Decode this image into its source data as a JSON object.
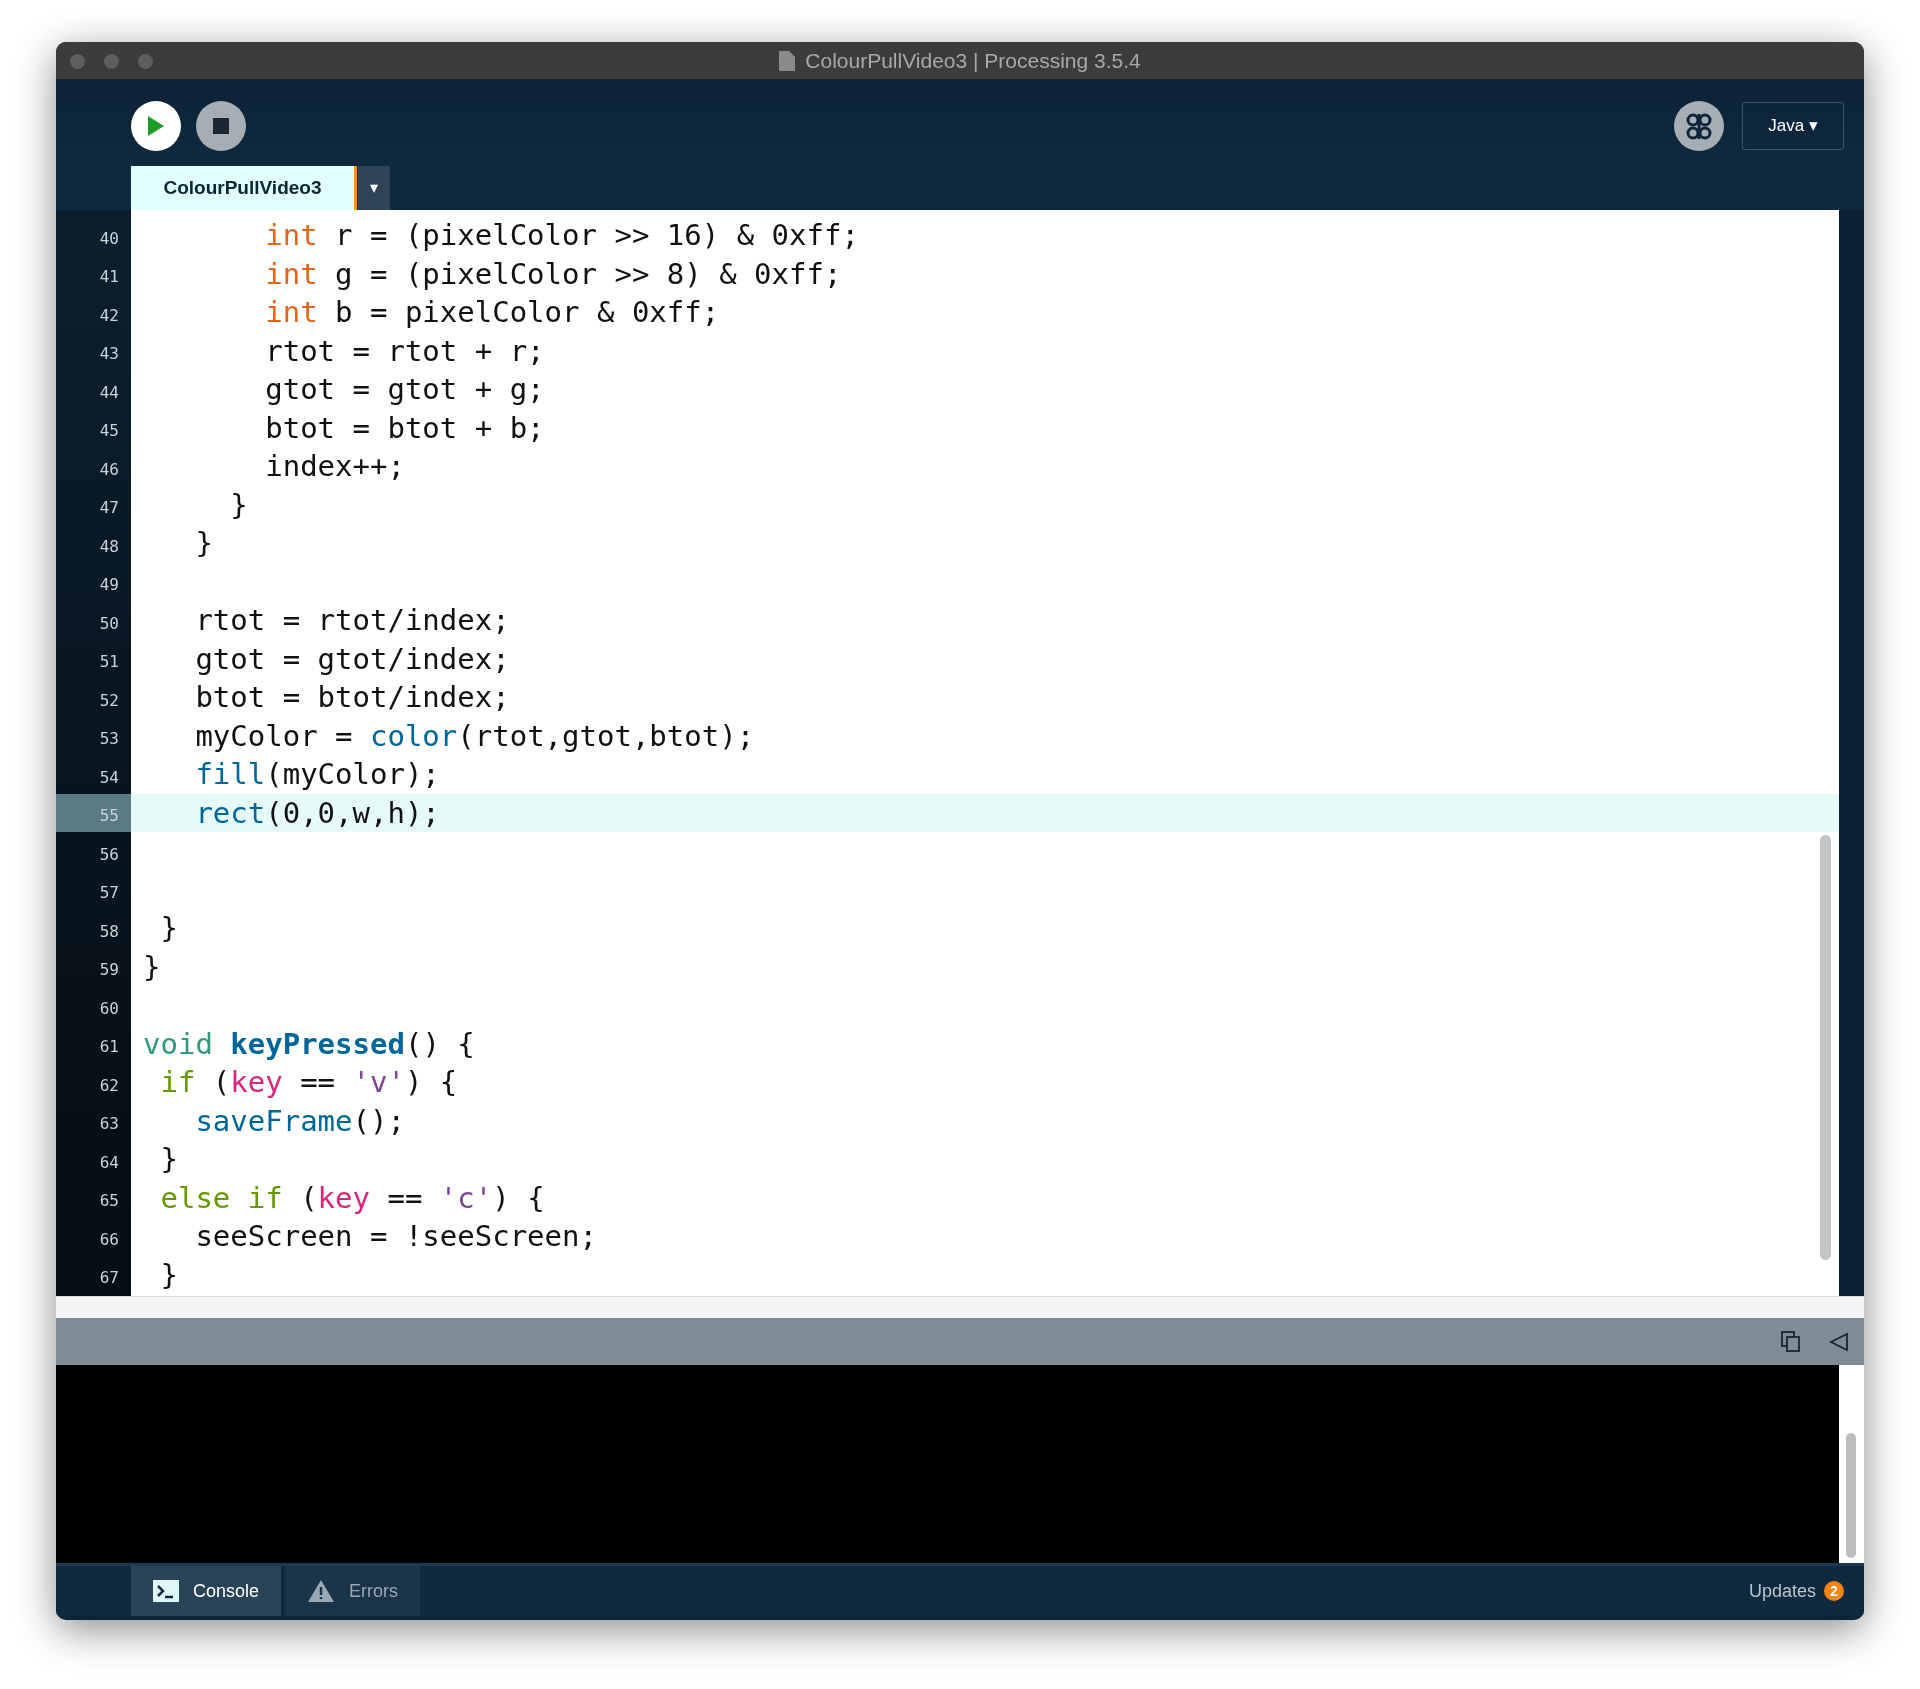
{
  "window": {
    "title": "ColourPullVideo3 | Processing 3.5.4"
  },
  "toolbar": {
    "mode": "Java ▾"
  },
  "tabs": [
    {
      "label": "ColourPullVideo3",
      "selected": true
    }
  ],
  "tab_menu": "▾",
  "editor": {
    "lines": [
      {
        "number": "40",
        "selected": false,
        "tokens": [
          {
            "kind": "type",
            "text": "       int"
          },
          {
            "kind": "plain",
            "text": " r = (pixelColor >> 16) & 0xff;"
          }
        ]
      },
      {
        "number": "41",
        "selected": false,
        "tokens": [
          {
            "kind": "type",
            "text": "       int"
          },
          {
            "kind": "plain",
            "text": " g = (pixelColor >> 8) & 0xff;"
          }
        ]
      },
      {
        "number": "42",
        "selected": false,
        "tokens": [
          {
            "kind": "type",
            "text": "       int"
          },
          {
            "kind": "plain",
            "text": " b = pixelColor & 0xff;"
          }
        ]
      },
      {
        "number": "43",
        "selected": false,
        "tokens": [
          {
            "kind": "plain",
            "text": "       rtot = rtot + r;"
          }
        ]
      },
      {
        "number": "44",
        "selected": false,
        "tokens": [
          {
            "kind": "plain",
            "text": "       gtot = gtot + g;"
          }
        ]
      },
      {
        "number": "45",
        "selected": false,
        "tokens": [
          {
            "kind": "plain",
            "text": "       btot = btot + b;"
          }
        ]
      },
      {
        "number": "46",
        "selected": false,
        "tokens": [
          {
            "kind": "plain",
            "text": "       index++;"
          }
        ]
      },
      {
        "number": "47",
        "selected": false,
        "tokens": [
          {
            "kind": "plain",
            "text": "     }"
          }
        ]
      },
      {
        "number": "48",
        "selected": false,
        "tokens": [
          {
            "kind": "plain",
            "text": "   }"
          }
        ]
      },
      {
        "number": "49",
        "selected": false
      },
      {
        "number": "50",
        "selected": false,
        "tokens": [
          {
            "kind": "plain",
            "text": "   rtot = rtot/index;"
          }
        ]
      },
      {
        "number": "51",
        "selected": false,
        "tokens": [
          {
            "kind": "plain",
            "text": "   gtot = gtot/index;"
          }
        ]
      },
      {
        "number": "52",
        "selected": false,
        "tokens": [
          {
            "kind": "plain",
            "text": "   btot = btot/index;"
          }
        ]
      },
      {
        "number": "53",
        "selected": false,
        "tokens": [
          {
            "kind": "plain",
            "text": "   myColor = "
          },
          {
            "kind": "function",
            "text": "color"
          },
          {
            "kind": "plain",
            "text": "(rtot,gtot,btot);"
          }
        ]
      },
      {
        "number": "54",
        "selected": false,
        "tokens": [
          {
            "kind": "function",
            "text": "   fill"
          },
          {
            "kind": "plain",
            "text": "(myColor);"
          }
        ]
      },
      {
        "number": "55",
        "selected": true,
        "tokens": [
          {
            "kind": "function",
            "text": "   rect"
          },
          {
            "kind": "plain",
            "text": "(0,0,w,h);"
          }
        ]
      },
      {
        "number": "56",
        "selected": false
      },
      {
        "number": "57",
        "selected": false
      },
      {
        "number": "58",
        "selected": false,
        "tokens": [
          {
            "kind": "plain",
            "text": " }"
          }
        ]
      },
      {
        "number": "59",
        "selected": false,
        "tokens": [
          {
            "kind": "plain",
            "text": "}"
          }
        ]
      },
      {
        "number": "60",
        "selected": false
      },
      {
        "number": "61",
        "selected": false,
        "tokens": [
          {
            "kind": "decl",
            "text": "void "
          },
          {
            "kind": "method",
            "text": "keyPressed"
          },
          {
            "kind": "plain",
            "text": "() {"
          }
        ]
      },
      {
        "number": "62",
        "selected": false,
        "tokens": [
          {
            "kind": "keyword",
            "text": " if"
          },
          {
            "kind": "plain",
            "text": " ("
          },
          {
            "kind": "variable",
            "text": "key"
          },
          {
            "kind": "plain",
            "text": " == "
          },
          {
            "kind": "string",
            "text": "'v'"
          },
          {
            "kind": "plain",
            "text": ") {"
          }
        ]
      },
      {
        "number": "63",
        "selected": false,
        "tokens": [
          {
            "kind": "function",
            "text": "   saveFrame"
          },
          {
            "kind": "plain",
            "text": "();"
          }
        ]
      },
      {
        "number": "64",
        "selected": false,
        "tokens": [
          {
            "kind": "plain",
            "text": " }"
          }
        ]
      },
      {
        "number": "65",
        "selected": false,
        "tokens": [
          {
            "kind": "keyword",
            "text": " else if"
          },
          {
            "kind": "plain",
            "text": " ("
          },
          {
            "kind": "variable",
            "text": "key"
          },
          {
            "kind": "plain",
            "text": " == "
          },
          {
            "kind": "string",
            "text": "'c'"
          },
          {
            "kind": "plain",
            "text": ") {"
          }
        ]
      },
      {
        "number": "66",
        "selected": false,
        "tokens": [
          {
            "kind": "plain",
            "text": "   seeScreen = !seeScreen;"
          }
        ]
      },
      {
        "number": "67",
        "selected": false,
        "tokens": [
          {
            "kind": "plain",
            "text": " }"
          }
        ]
      }
    ]
  },
  "footer_tabs": [
    {
      "label": "Console",
      "kind": "console",
      "selected": true
    },
    {
      "label": "Errors",
      "kind": "errors",
      "selected": false
    }
  ],
  "updates": {
    "label": "Updates",
    "count": "2"
  }
}
